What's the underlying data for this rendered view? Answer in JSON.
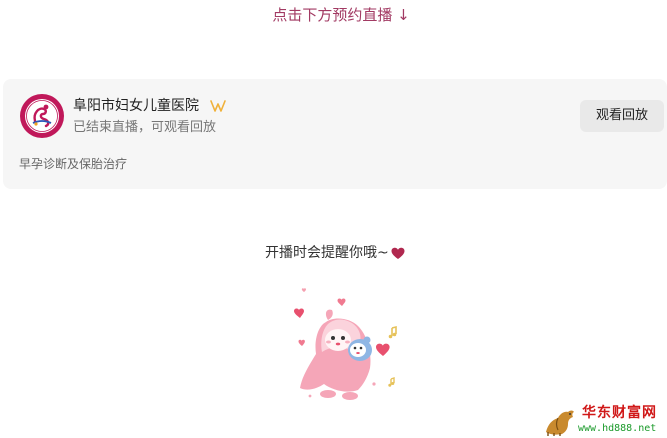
{
  "top_hint": "点击下方预约直播 ↓",
  "card": {
    "org_name": "阜阳市妇女儿童医院",
    "status": "已结束直播，可观看回放",
    "replay_label": "观看回放",
    "description": "早孕诊断及保胎治疗"
  },
  "reminder": {
    "text": "开播时会提醒你哦~"
  },
  "watermark": {
    "title": "华东财富网",
    "url": "www.hd888.net"
  },
  "colors": {
    "hint": "#a23a63",
    "heart": "#b0284f",
    "button_bg": "#e9e9e9",
    "card_bg": "#f6f6f6",
    "verified": "#f0b13a",
    "watermark_red": "#d01818",
    "watermark_green": "#1a9a2a"
  },
  "icons": {
    "verified": "verified-badge-icon",
    "heart": "heart-icon",
    "logo": "hospital-logo"
  }
}
